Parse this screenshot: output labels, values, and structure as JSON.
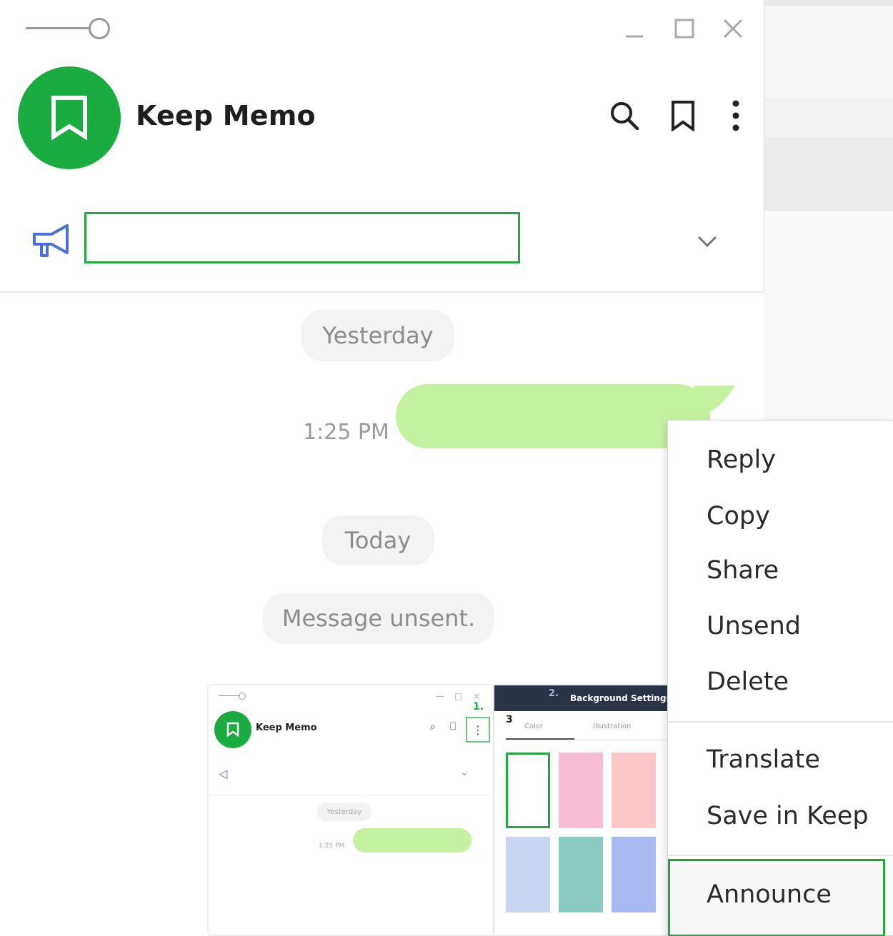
{
  "window": {
    "title": "Keep Memo"
  },
  "announcement": {
    "text": ""
  },
  "chat": {
    "date_yesterday": "Yesterday",
    "date_today": "Today",
    "message_time": "1:25 PM",
    "unsent_notice": "Message unsent."
  },
  "thumbnail": {
    "window_title": "Keep Memo",
    "step1": "1.",
    "step2": "2.",
    "step3": "3",
    "panel_title": "Background Settings",
    "tab_color": "Color",
    "tab_illustration": "Illustration",
    "date_yesterday": "Yesterday",
    "message_time": "1:25 PM",
    "swatch_colors": [
      "#ffffff",
      "#f6bcd6",
      "#fbc7c9",
      "#c8d6f2",
      "#8ccbc2",
      "#a8baf1"
    ]
  },
  "context_menu": {
    "items": [
      "Reply",
      "Copy",
      "Share",
      "Unsend",
      "Delete",
      "Translate",
      "Save in Keep",
      "Announce"
    ]
  },
  "colors": {
    "brand_green": "#1aab41",
    "bubble_green": "#c5f2a1",
    "highlight_border": "#22a83e",
    "megaphone_blue": "#4a6fd8"
  },
  "icons": {
    "window": [
      "slider-icon",
      "minimize-icon",
      "maximize-icon",
      "close-icon"
    ],
    "header": [
      "bookmark-icon",
      "search-icon",
      "keep-icon",
      "more-icon"
    ],
    "announcement": [
      "megaphone-icon",
      "chevron-down-icon"
    ]
  }
}
